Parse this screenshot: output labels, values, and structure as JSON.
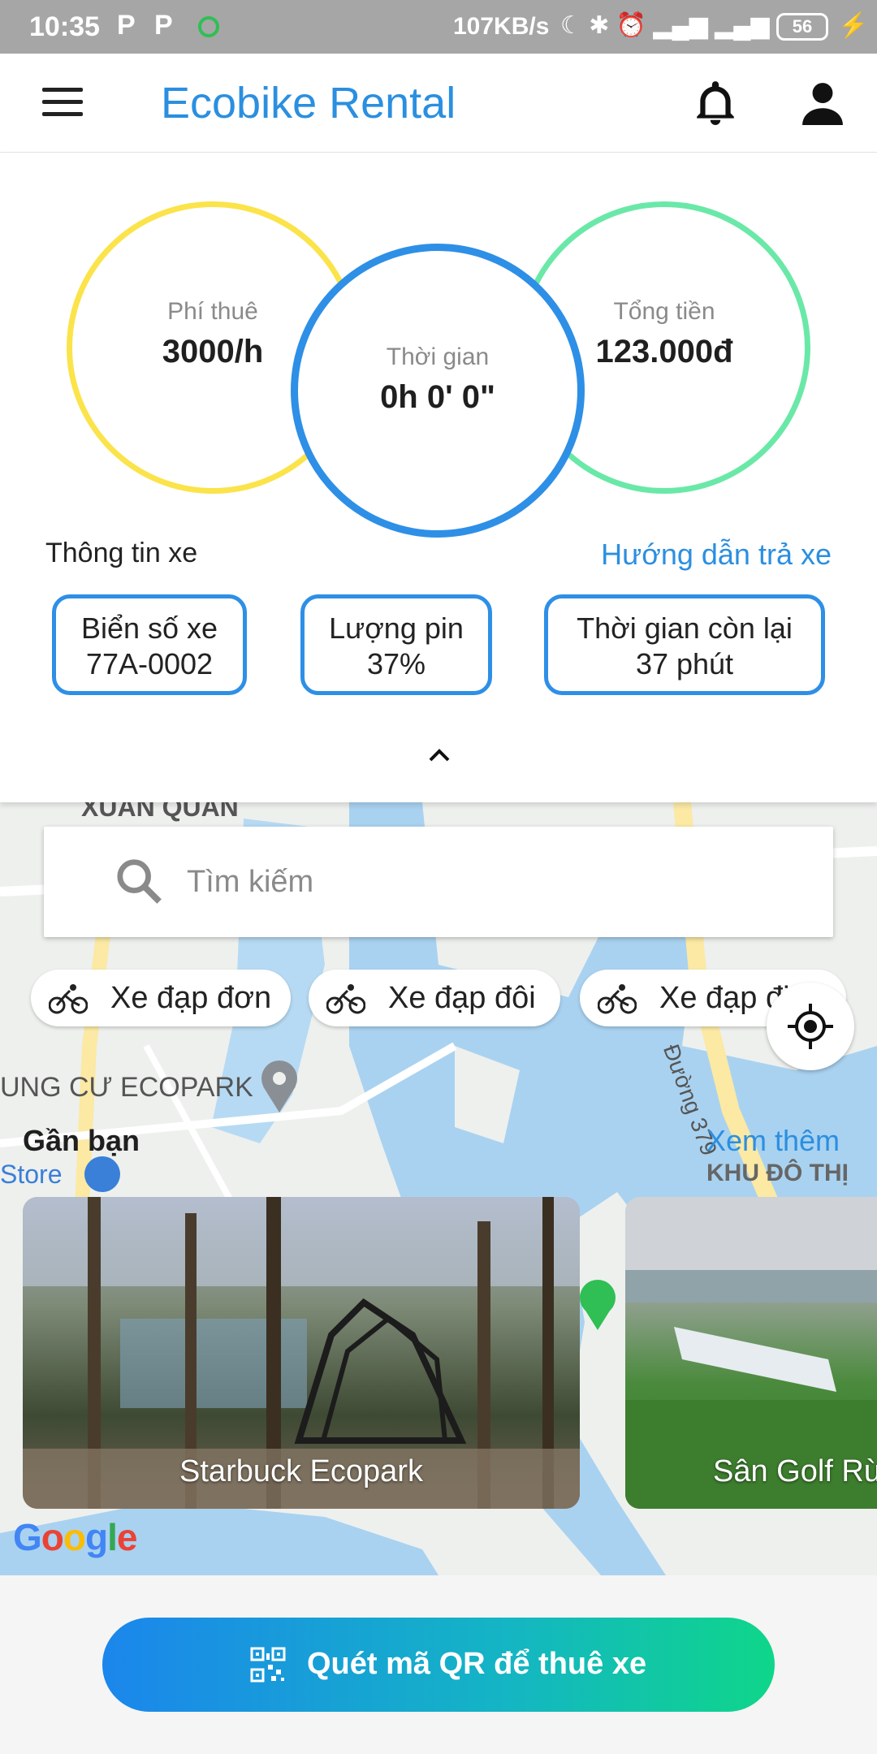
{
  "status_bar": {
    "time": "10:35",
    "notif1": "P",
    "notif2": "P",
    "speed": "107KB/s",
    "battery": "56"
  },
  "app_bar": {
    "title": "Ecobike Rental"
  },
  "stats": {
    "rent_fee_label": "Phí thuê",
    "rent_fee_value": "3000/h",
    "time_label": "Thời gian",
    "time_value": "0h 0' 0\"",
    "total_label": "Tổng tiền",
    "total_value": "123.000đ"
  },
  "bike_info": {
    "title": "Thông tin xe",
    "guide_link": "Hướng dẫn trả xe",
    "plate_label": "Biển số xe",
    "plate_value": "77A-0002",
    "battery_label": "Lượng pin",
    "battery_value": "37%",
    "remaining_label": "Thời gian còn lại",
    "remaining_value": "37 phút"
  },
  "search": {
    "placeholder": "Tìm kiếm"
  },
  "chips": [
    "Xe đạp đơn",
    "Xe đạp đôi",
    "Xe đạp điện"
  ],
  "map_labels": {
    "xuan_quan": "XUÂN QUAN",
    "chung_cu": "UNG CƯ ECOPARK",
    "duong": "Đường 379",
    "store": "Store",
    "khu_do_thi": "KHU ĐÔ THỊ"
  },
  "nearby": {
    "title": "Gần bạn",
    "see_more": "Xem thêm",
    "cards": [
      "Starbuck Ecopark",
      "Sân Golf Rừng Cọ"
    ]
  },
  "google": "Google",
  "qr_button": {
    "label": "Quét mã QR để thuê xe"
  },
  "colors": {
    "brand_blue": "#2b8fe0",
    "yellow_ring": "#fbe34a",
    "green_ring": "#6ae8a8",
    "blue_ring": "#2e8fe6"
  }
}
